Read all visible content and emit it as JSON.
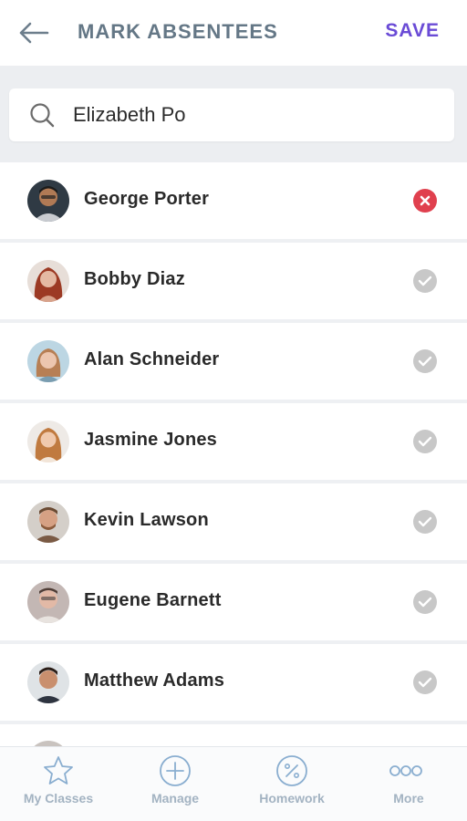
{
  "header": {
    "title": "MARK ABSENTEES",
    "save_label": "SAVE",
    "back_icon": "arrow-left-icon"
  },
  "search": {
    "value": "Elizabeth Po",
    "icon": "search-icon"
  },
  "students": [
    {
      "name": "George Porter",
      "status": "absent"
    },
    {
      "name": "Bobby Diaz",
      "status": "present"
    },
    {
      "name": "Alan Schneider",
      "status": "present"
    },
    {
      "name": "Jasmine Jones",
      "status": "present"
    },
    {
      "name": "Kevin Lawson",
      "status": "present"
    },
    {
      "name": "Eugene Barnett",
      "status": "present"
    },
    {
      "name": "Matthew Adams",
      "status": "present"
    }
  ],
  "tabs": [
    {
      "label": "My Classes",
      "icon": "star-icon"
    },
    {
      "label": "Manage",
      "icon": "plus-circle-icon"
    },
    {
      "label": "Homework",
      "icon": "percent-circle-icon"
    },
    {
      "label": "More",
      "icon": "more-dots-icon"
    }
  ],
  "colors": {
    "accent": "#6a4bd6",
    "absent": "#e0404e",
    "present": "#c8c8c8",
    "title": "#647786",
    "tab_label": "#a3b3c2"
  }
}
